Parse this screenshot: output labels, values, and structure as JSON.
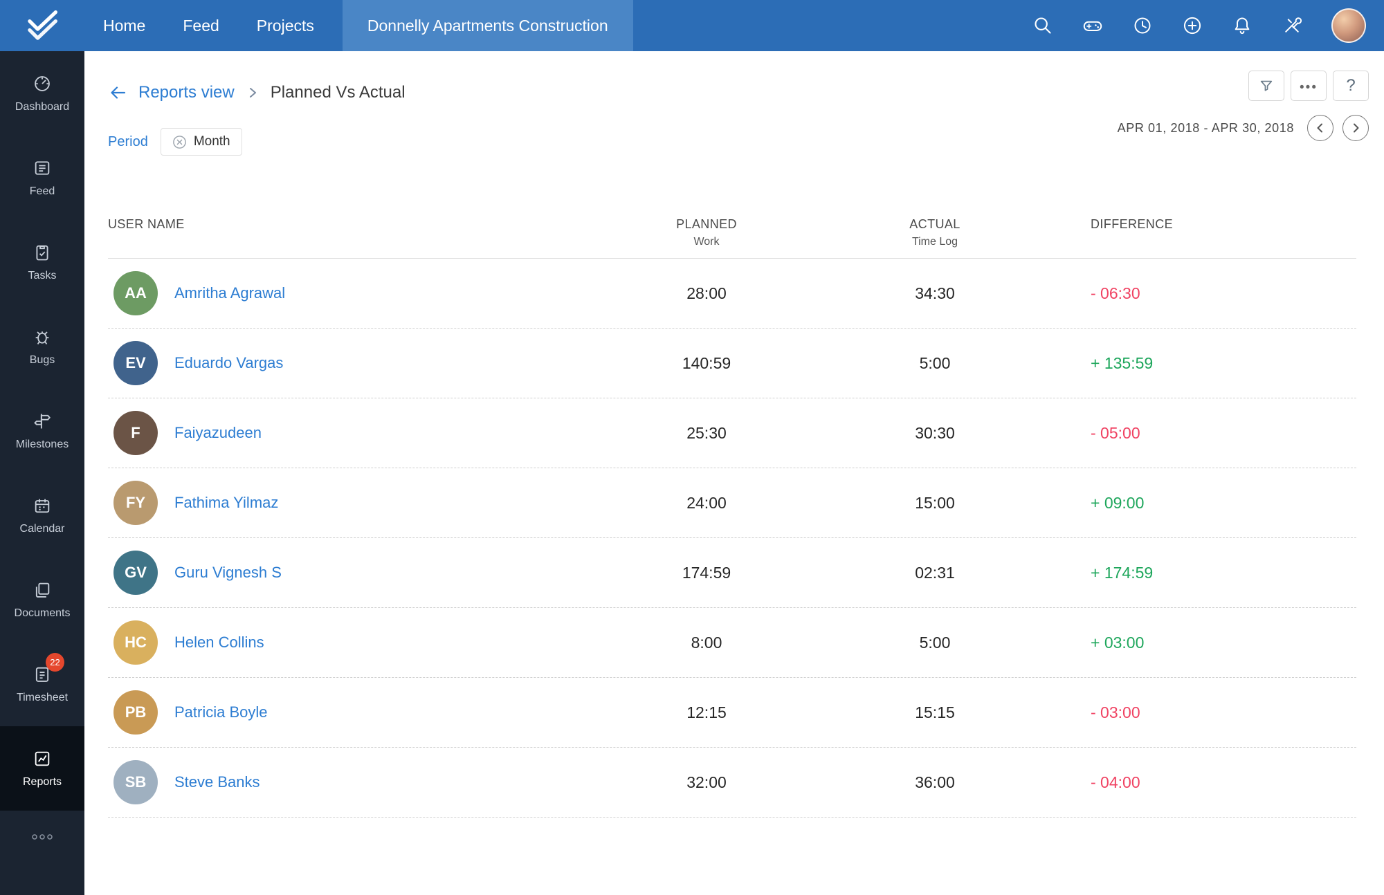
{
  "topbar": {
    "nav_items": [
      {
        "label": "Home"
      },
      {
        "label": "Feed"
      },
      {
        "label": "Projects"
      }
    ],
    "active_project": "Donnelly Apartments Construction",
    "icon_names": [
      "search-icon",
      "games-icon",
      "history-icon",
      "add-icon",
      "notifications-icon",
      "tools-icon",
      "user-avatar"
    ]
  },
  "sidebar": {
    "items": [
      {
        "label": "Dashboard",
        "icon": "dashboard-icon"
      },
      {
        "label": "Feed",
        "icon": "feed-icon"
      },
      {
        "label": "Tasks",
        "icon": "tasks-icon"
      },
      {
        "label": "Bugs",
        "icon": "bugs-icon"
      },
      {
        "label": "Milestones",
        "icon": "milestones-icon"
      },
      {
        "label": "Calendar",
        "icon": "calendar-icon"
      },
      {
        "label": "Documents",
        "icon": "documents-icon"
      },
      {
        "label": "Timesheet",
        "icon": "timesheet-icon",
        "badge": "22"
      },
      {
        "label": "Reports",
        "icon": "reports-icon",
        "active": true
      }
    ],
    "more_icon": "more-icon"
  },
  "breadcrumb": {
    "back_label": "Reports view",
    "current": "Planned Vs Actual"
  },
  "toolbar": {
    "filter_icon": "filter-icon",
    "more_label": "•••",
    "help_label": "?"
  },
  "filters": {
    "period_label": "Period",
    "chip_label": "Month"
  },
  "date_range": {
    "label": "APR 01, 2018 - APR 30, 2018"
  },
  "table": {
    "headers": {
      "user": "USER NAME",
      "planned": "PLANNED",
      "planned_sub": "Work",
      "actual": "ACTUAL",
      "actual_sub": "Time Log",
      "difference": "DIFFERENCE"
    },
    "rows": [
      {
        "name": "Amritha Agrawal",
        "initials": "AA",
        "avatar_style": "background:#6d9b63",
        "planned": "28:00",
        "actual": "34:30",
        "difference": "- 06:30",
        "diff_style": "color:#f04262"
      },
      {
        "name": "Eduardo Vargas",
        "initials": "EV",
        "avatar_style": "background:#40638c",
        "planned": "140:59",
        "actual": "5:00",
        "difference": "+ 135:59",
        "diff_style": "color:#1da65b"
      },
      {
        "name": "Faiyazudeen",
        "initials": "F",
        "avatar_style": "background:#6b5446",
        "planned": "25:30",
        "actual": "30:30",
        "difference": "- 05:00",
        "diff_style": "color:#f04262"
      },
      {
        "name": "Fathima Yilmaz",
        "initials": "FY",
        "avatar_style": "background:#b99a6f",
        "planned": "24:00",
        "actual": "15:00",
        "difference": "+ 09:00",
        "diff_style": "color:#1da65b"
      },
      {
        "name": "Guru Vignesh S",
        "initials": "GV",
        "avatar_style": "background:#3f7487",
        "planned": "174:59",
        "actual": "02:31",
        "difference": "+ 174:59",
        "diff_style": "color:#1da65b"
      },
      {
        "name": "Helen Collins",
        "initials": "HC",
        "avatar_style": "background:#d9b05e",
        "planned": "8:00",
        "actual": "5:00",
        "difference": "+ 03:00",
        "diff_style": "color:#1da65b"
      },
      {
        "name": "Patricia Boyle",
        "initials": "PB",
        "avatar_style": "background:#c99a55",
        "planned": "12:15",
        "actual": "15:15",
        "difference": "- 03:00",
        "diff_style": "color:#f04262"
      },
      {
        "name": "Steve Banks",
        "initials": "SB",
        "avatar_style": "background:#9fb0c0",
        "planned": "32:00",
        "actual": "36:00",
        "difference": "- 04:00",
        "diff_style": "color:#f04262"
      }
    ]
  },
  "colors": {
    "topbar_bg": "#2c6db6",
    "active_tab_bg": "#4a86c6",
    "sidebar_bg": "#1b2431",
    "sidebar_active_bg": "#0b1118",
    "link_blue": "#2d7dd2",
    "negative_red": "#f04262",
    "positive_green": "#1da65b",
    "badge_red": "#e5472d"
  }
}
